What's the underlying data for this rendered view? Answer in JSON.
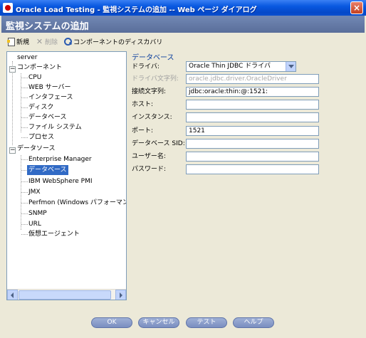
{
  "window": {
    "title": "Oracle Load Testing - 監視システムの追加 -- Web ページ ダイアログ",
    "close_symbol": "×"
  },
  "dialog": {
    "title": "監視システムの追加"
  },
  "toolbar": {
    "new_label": "新規",
    "delete_label": "削除",
    "discover_label": "コンポーネントのディスカバリ"
  },
  "tree": {
    "root": "server",
    "components_group": "コンポーネント",
    "components": [
      "CPU",
      "WEB サーバー",
      "インタフェース",
      "ディスク",
      "データベース",
      "ファイル システム",
      "プロセス"
    ],
    "datasources_group": "データソース",
    "datasources": [
      "Enterprise Manager",
      "データベース",
      "IBM WebSphere PMI",
      "JMX",
      "Perfmon (Windows パフォーマンス",
      "SNMP",
      "URL",
      "仮想エージェント"
    ],
    "selected": "データベース",
    "expander_symbol": "−"
  },
  "form": {
    "section_title": "データベース",
    "driver_label": "ドライバ:",
    "driver_value": "Oracle Thin JDBC ドライバ",
    "driver_string_label": "ドライバ文字列:",
    "driver_string_value": "oracle.jdbc.driver.OracleDriver",
    "connection_string_label": "接続文字列:",
    "connection_string_value": "jdbc:oracle:thin:@:1521:",
    "host_label": "ホスト:",
    "host_value": "",
    "instance_label": "インスタンス:",
    "instance_value": "",
    "port_label": "ポート:",
    "port_value": "1521",
    "sid_label": "データベース SID:",
    "sid_value": "",
    "username_label": "ユーザー名:",
    "username_value": "",
    "password_label": "パスワード:",
    "password_value": ""
  },
  "buttons": {
    "ok": "OK",
    "cancel": "キャンセル",
    "test": "テスト",
    "help": "ヘルプ"
  }
}
